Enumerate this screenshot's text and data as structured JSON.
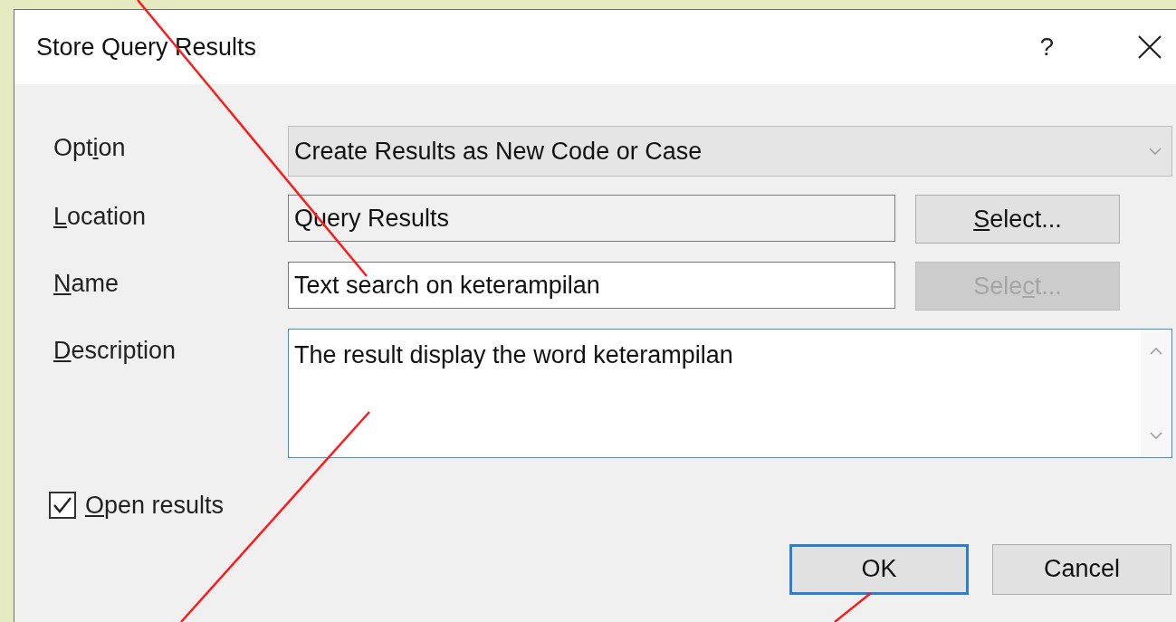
{
  "window": {
    "title": "Store Query Results",
    "help": "?"
  },
  "fields": [
    {
      "kind": "combo",
      "label": {
        "before": "Opt",
        "key": "i",
        "after": "on"
      },
      "value": "Create Results as New Code or Case"
    },
    {
      "kind": "text",
      "label": {
        "key": "L",
        "after": "ocation"
      },
      "value": "Query Results",
      "readonly": true,
      "button": {
        "label": {
          "key": "S",
          "after": "elect..."
        },
        "disabled": false
      }
    },
    {
      "kind": "text",
      "label": {
        "key": "N",
        "after": "ame"
      },
      "value": "Text search on keterampilan",
      "readonly": false,
      "button": {
        "label": {
          "before": "Sele",
          "key": "c",
          "after": "t..."
        },
        "disabled": true
      }
    },
    {
      "kind": "memo",
      "label": {
        "key": "D",
        "after": "escription"
      },
      "value": "The result display the word keterampilan",
      "focused": true
    }
  ],
  "open_results": {
    "label": {
      "key": "O",
      "after": "pen results"
    },
    "checked": true
  },
  "buttons": [
    {
      "label": "OK",
      "default": true
    },
    {
      "label": "Cancel",
      "default": false
    }
  ]
}
